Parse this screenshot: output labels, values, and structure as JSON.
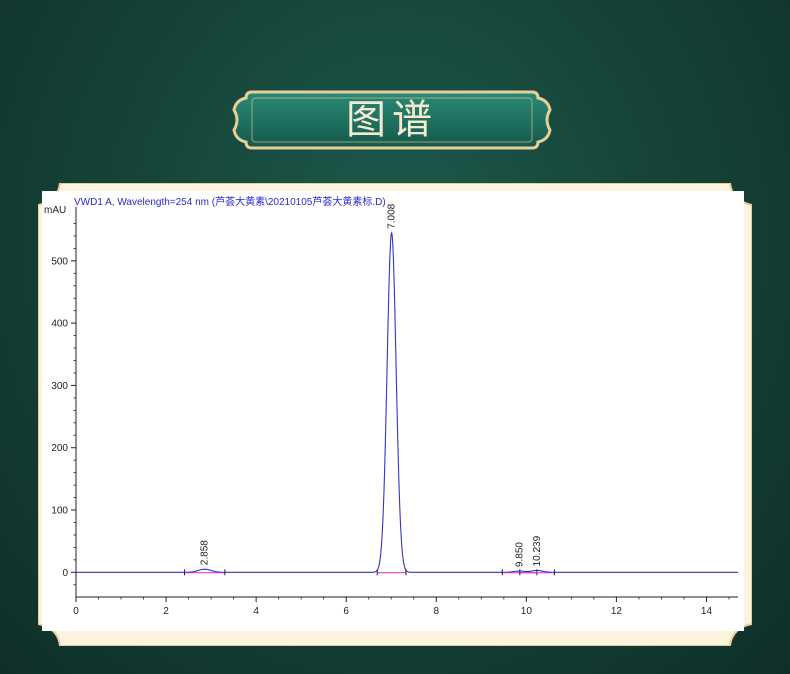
{
  "header": {
    "title": "图谱"
  },
  "chart_data": {
    "type": "line",
    "header_text": "VWD1 A, Wavelength=254 nm (芦荟大黄素\\20210105芦荟大黄素标.D)",
    "ylabel": "mAU",
    "xlabel": "",
    "xlim": [
      0,
      14.7
    ],
    "ylim": [
      -30,
      580
    ],
    "xticks": [
      0,
      2,
      4,
      6,
      8,
      10,
      12,
      14
    ],
    "yticks": [
      0,
      100,
      200,
      300,
      400,
      500
    ],
    "peaks": [
      {
        "label": "2.858",
        "rt": 2.858,
        "height": 5,
        "width": 0.14
      },
      {
        "label": "7.008",
        "rt": 7.008,
        "height": 545,
        "width": 0.1
      },
      {
        "label": "9.850",
        "rt": 9.85,
        "height": 2,
        "width": 0.12
      },
      {
        "label": "10.239",
        "rt": 10.239,
        "height": 3,
        "width": 0.12
      }
    ],
    "colors": {
      "signal": "#3434c8",
      "baseline": "#e020e0",
      "axis": "#222222",
      "header": "#2a2ad8"
    }
  }
}
